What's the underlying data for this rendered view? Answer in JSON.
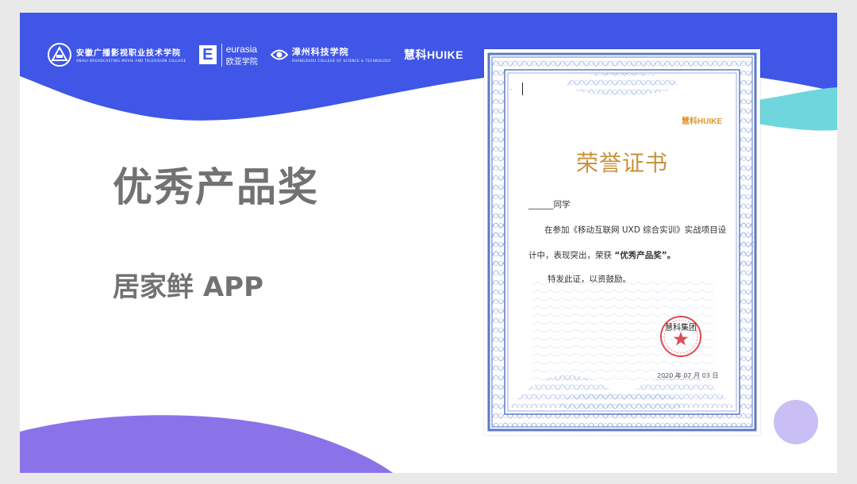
{
  "colors": {
    "blue": "#3f56e6",
    "purple": "#8a73e8",
    "teal": "#6ed6dc",
    "lavender": "#c9bff5",
    "title_gray": "#727272",
    "gold": "#c9913a",
    "orange": "#e2962c",
    "seal_red": "#e04a52"
  },
  "logos": {
    "college1_cn": "安徽广播影视职业技术学院",
    "college1_en": "ANHUI BROADCASTING MOVIE AND TELEVISION COLLEGE",
    "eurasia_en": "eurasia",
    "eurasia_cn": "欧亚学院",
    "zhangzhou_cn": "漳州科技学院",
    "zhangzhou_en": "ZHANGZHOU COLLEGE OF SCIENCE & TECHNOLOGY",
    "huike": "慧科HUIKE"
  },
  "slide": {
    "award_title": "优秀产品奖",
    "award_subtitle": "居家鲜 APP"
  },
  "certificate": {
    "brand": "慧科HUIKE",
    "title": "荣誉证书",
    "recipient_line": "______同学",
    "body_line1": "在参加《移动互联网 UXD 综合实训》实战项目设",
    "body_line2_prefix": "计中，表现突出，荣获 ",
    "body_line2_award": "“优秀产品奖”。",
    "body_line3": "特发此证，以资鼓励。",
    "seal_text": "慧科集团",
    "date": "2020 年 07 月 03 日",
    "mark": "-"
  }
}
